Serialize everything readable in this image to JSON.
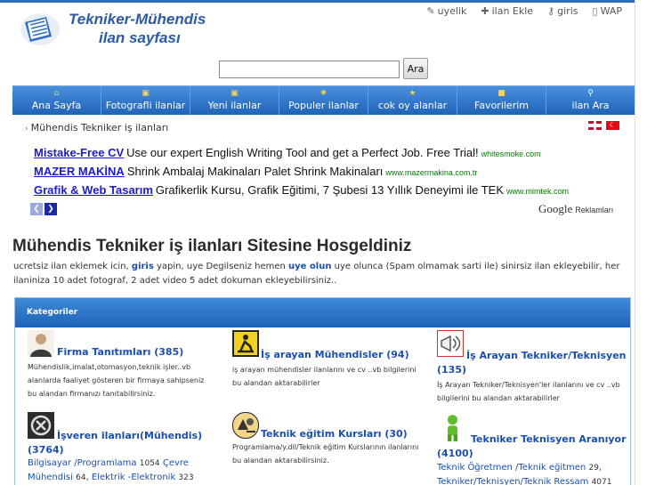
{
  "header": {
    "logo_line1": "Tekniker-Mühendis",
    "logo_line2": "ilan sayfası",
    "links": [
      {
        "icon": "pencil-icon",
        "glyph": "✎",
        "label": "uyelik"
      },
      {
        "icon": "add-listing-icon",
        "glyph": "✚",
        "label": "ilan Ekle"
      },
      {
        "icon": "key-icon",
        "glyph": "⚷",
        "label": "giris"
      },
      {
        "icon": "mobile-icon",
        "glyph": "▯",
        "label": "WAP"
      }
    ]
  },
  "search": {
    "value": "",
    "placeholder": "",
    "button_label": "Ara"
  },
  "nav": [
    {
      "icon": "home-icon",
      "glyph": "⌂",
      "label": "Ana Sayfa"
    },
    {
      "icon": "photo-icon",
      "glyph": "▣",
      "label": "Fotografli ilanlar"
    },
    {
      "icon": "new-icon",
      "glyph": "▣",
      "label": "Yeni ilanlar"
    },
    {
      "icon": "popular-icon",
      "glyph": "✸",
      "label": "Populer ilanlar"
    },
    {
      "icon": "star-icon",
      "glyph": "★",
      "label": "cok oy alanlar"
    },
    {
      "icon": "favorites-icon",
      "glyph": "■",
      "label": "Favorilerim"
    },
    {
      "icon": "magnifier-icon",
      "glyph": "⚲",
      "label": "ilan Ara"
    }
  ],
  "breadcrumb": {
    "label": "Mühendis Tekniker iş ilanları"
  },
  "ads": [
    {
      "title": "Mistake-Free CV",
      "text": "Use our expert English Writing Tool and get a Perfect Job. Free Trial!",
      "url": "whitesmoke.com"
    },
    {
      "title": "MAZER MAKİNA",
      "text": "Shrink Ambalaj Makinaları Palet Shrink Makinaları",
      "url": "www.mazermakina.com.tr"
    },
    {
      "title": "Grafik & Web Tasarım",
      "text": "Grafikerlik Kursu, Grafik Eğitimi, 7 Şubesi 13 Yıllık Deneyimi ile TEK",
      "url": "www.mimtek.com"
    }
  ],
  "google": {
    "word": "Google",
    "label": "Reklamları"
  },
  "welcome": {
    "title": "Mühendis Tekniker iş ilanları Sitesine Hosgeldiniz",
    "part1": "ucretsiz ilan eklemek icin, ",
    "link1": "giris",
    "part2": " yapin, uye Degilseniz hemen ",
    "link2": "uye olun",
    "part3": " uye olunca (Spam olmamak sarti ile) sinirsiz ilan ekleyebilir, her ilaniniza 10 adet fotograf, 2 adet video 5 adet dokuman ekleyebilirsiniz.."
  },
  "categories": {
    "header": "Kategoriler",
    "items": [
      {
        "icon": "person-icon",
        "title": "Firma Tanıtımları (385)",
        "desc": "Mühendislik,imalat,otomasyon,teknik işler..vb alanlarda faaliyet gösteren bir firmaya sahipseniz bu alandan firmanızı tanıtabilirsiniz."
      },
      {
        "icon": "worker-sign-icon",
        "title": "İş arayan Mühendisler (94)",
        "desc": "iş arayan mühendisler ilanlarını ve cv ..vb bilgilerini bu alandan aktarabilirler"
      },
      {
        "icon": "megaphone-icon",
        "title_a": "İş Arayan Tekniker/Teknisyen",
        "title_b": "(135)",
        "desc": "İş Arayan Tekniker/Teknisyen'ler ilanlarını ve cv ..vb bilgilerini bu alandan aktarabilirler"
      },
      {
        "icon": "gear-icon",
        "title_a": "İşveren ilanları(Mühendis)",
        "title_b": "(3764)",
        "subs": [
          {
            "name": "Bilgisayar /Programlama",
            "count": "1054"
          },
          {
            "name": "Çevre Mühendisi",
            "count": "64"
          },
          {
            "name": "Elektrik -Elektronik",
            "count": "323"
          }
        ]
      },
      {
        "icon": "education-icon",
        "title": "Teknik eğitim Kursları (30)",
        "desc": "Programlama/y.dil/Teknik eğitim Kurslarının ilanlarını bu alandan aktarabilirsiniz."
      },
      {
        "icon": "green-person-icon",
        "title_a": "Tekniker Teknisyen Aranıyor",
        "title_b": "(4100)",
        "subs": [
          {
            "name": "Teknik Öğretmen /Teknik eğitmen",
            "count": "29"
          },
          {
            "name": "Tekniker/Teknisyen/Teknik Ressam",
            "count": "4071"
          }
        ]
      }
    ]
  },
  "colors": {
    "nav": "#2f74c8",
    "link": "#1a4fb0",
    "ad_title": "#1a1ad0",
    "ad_url": "#008000"
  }
}
